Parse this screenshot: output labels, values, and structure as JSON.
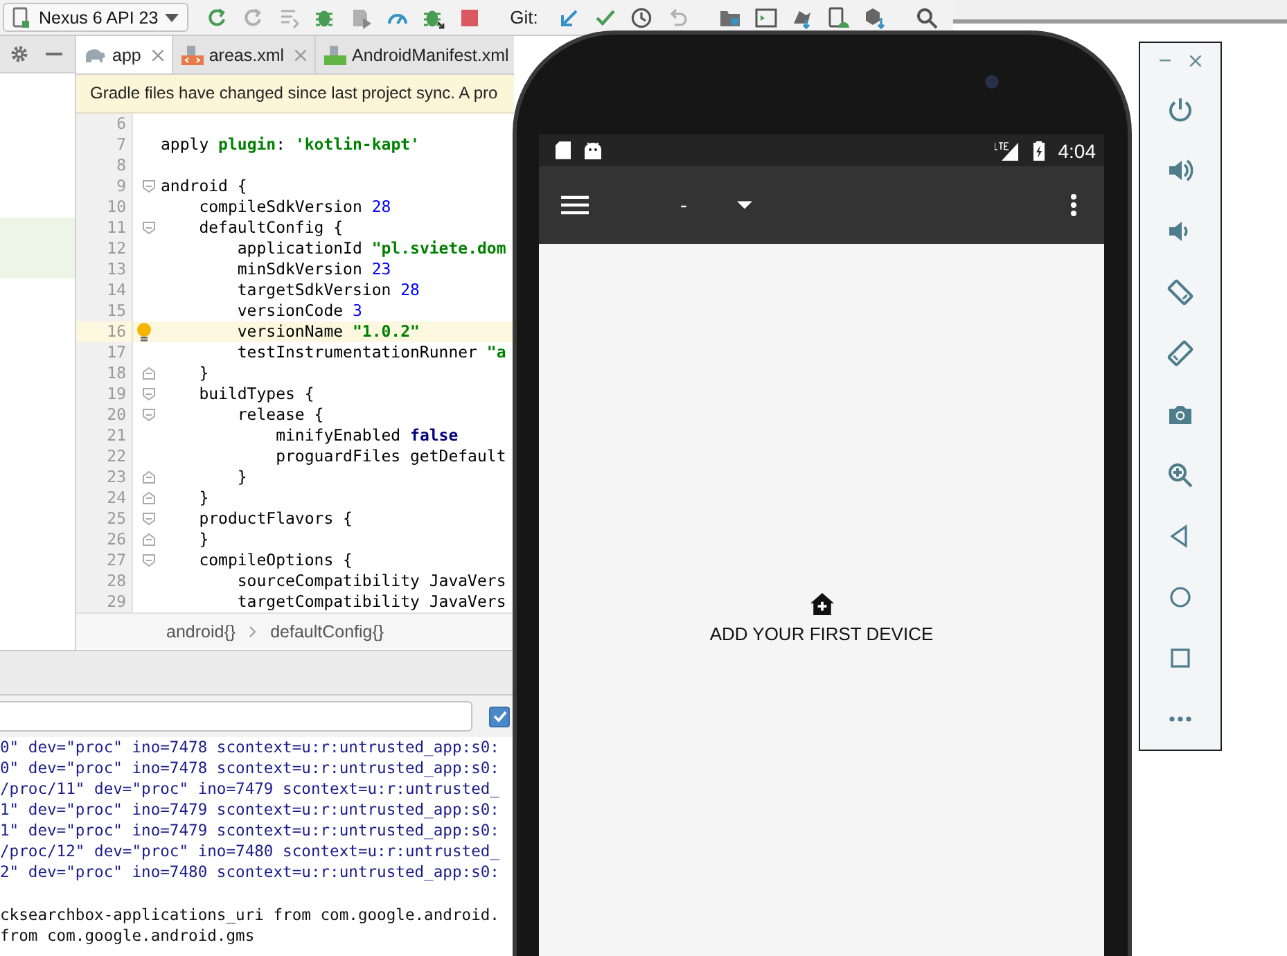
{
  "toolbar": {
    "device_selector": "Nexus 6 API 23",
    "run_buttons": [
      {
        "kind": "run",
        "disabled": false
      },
      {
        "kind": "apply-changes",
        "disabled": true
      },
      {
        "kind": "apply-code",
        "disabled": true
      },
      {
        "kind": "debug",
        "disabled": false
      },
      {
        "kind": "attach-debugger",
        "disabled": true
      },
      {
        "kind": "profile",
        "disabled": false
      },
      {
        "kind": "debug-attach",
        "disabled": false
      },
      {
        "kind": "stop",
        "disabled": false
      }
    ],
    "git_label": "Git:",
    "git_buttons": [
      {
        "kind": "update",
        "disabled": false
      },
      {
        "kind": "commit",
        "disabled": false
      },
      {
        "kind": "history",
        "disabled": false
      },
      {
        "kind": "revert",
        "disabled": true
      }
    ],
    "tool_buttons": [
      {
        "kind": "project-structure"
      },
      {
        "kind": "terminal"
      },
      {
        "kind": "sdk"
      },
      {
        "kind": "avd"
      },
      {
        "kind": "device-files"
      }
    ]
  },
  "editor_tabs": [
    {
      "label": "app",
      "kind": "gradle",
      "selected": true,
      "closable": true
    },
    {
      "label": "areas.xml",
      "kind": "xml",
      "selected": false,
      "closable": true
    },
    {
      "label": "AndroidManifest.xml",
      "kind": "manifest",
      "selected": false,
      "closable": false
    }
  ],
  "notification": "Gradle files have changed since last project sync. A pro",
  "code_lines": [
    {
      "number": "6"
    },
    {
      "number": "7",
      "tokens": [
        {
          "text": "apply ",
          "kind": "plain"
        },
        {
          "text": "plugin",
          "kind": "keyword-green"
        },
        {
          "text": ": ",
          "kind": "plain"
        },
        {
          "text": "'kotlin-kapt'",
          "kind": "string"
        }
      ]
    },
    {
      "number": "8"
    },
    {
      "number": "9",
      "fold_start": true,
      "tokens": [
        {
          "text": "android {",
          "kind": "plain"
        }
      ]
    },
    {
      "number": "10",
      "tokens": [
        {
          "text": "    compileSdkVersion ",
          "kind": "plain"
        },
        {
          "text": "28",
          "kind": "number"
        }
      ]
    },
    {
      "number": "11",
      "fold_start": true,
      "tokens": [
        {
          "text": "    defaultConfig {",
          "kind": "plain"
        }
      ]
    },
    {
      "number": "12",
      "tokens": [
        {
          "text": "        applicationId ",
          "kind": "plain"
        },
        {
          "text": "\"pl.sviete.dom",
          "kind": "string"
        }
      ]
    },
    {
      "number": "13",
      "tokens": [
        {
          "text": "        minSdkVersion ",
          "kind": "plain"
        },
        {
          "text": "23",
          "kind": "number"
        }
      ]
    },
    {
      "number": "14",
      "tokens": [
        {
          "text": "        targetSdkVersion ",
          "kind": "plain"
        },
        {
          "text": "28",
          "kind": "number"
        }
      ]
    },
    {
      "number": "15",
      "tokens": [
        {
          "text": "        versionCode ",
          "kind": "plain"
        },
        {
          "text": "3",
          "kind": "number"
        }
      ]
    },
    {
      "number": "16",
      "current": true,
      "bulb": true,
      "tokens": [
        {
          "text": "        versionName ",
          "kind": "plain"
        },
        {
          "text": "\"1.0.2\"",
          "kind": "string"
        }
      ]
    },
    {
      "number": "17",
      "tokens": [
        {
          "text": "        testInstrumentationRunner ",
          "kind": "plain"
        },
        {
          "text": "\"a",
          "kind": "string"
        }
      ]
    },
    {
      "number": "18",
      "fold_end": true,
      "tokens": [
        {
          "text": "    }",
          "kind": "plain"
        }
      ]
    },
    {
      "number": "19",
      "fold_start": true,
      "tokens": [
        {
          "text": "    buildTypes {",
          "kind": "plain"
        }
      ]
    },
    {
      "number": "20",
      "fold_start": true,
      "tokens": [
        {
          "text": "        release {",
          "kind": "plain"
        }
      ]
    },
    {
      "number": "21",
      "tokens": [
        {
          "text": "            minifyEnabled ",
          "kind": "plain"
        },
        {
          "text": "false",
          "kind": "keyword"
        }
      ]
    },
    {
      "number": "22",
      "tokens": [
        {
          "text": "            proguardFiles getDefault",
          "kind": "plain"
        }
      ]
    },
    {
      "number": "23",
      "fold_end": true,
      "tokens": [
        {
          "text": "        }",
          "kind": "plain"
        }
      ]
    },
    {
      "number": "24",
      "fold_end": true,
      "tokens": [
        {
          "text": "    }",
          "kind": "plain"
        }
      ]
    },
    {
      "number": "25",
      "fold_start": true,
      "tokens": [
        {
          "text": "    productFlavors {",
          "kind": "plain"
        }
      ]
    },
    {
      "number": "26",
      "fold_end": true,
      "tokens": [
        {
          "text": "    }",
          "kind": "plain"
        }
      ]
    },
    {
      "number": "27",
      "fold_start": true,
      "tokens": [
        {
          "text": "    compileOptions {",
          "kind": "plain"
        }
      ]
    },
    {
      "number": "28",
      "tokens": [
        {
          "text": "        sourceCompatibility JavaVers",
          "kind": "plain"
        }
      ]
    },
    {
      "number": "29",
      "tokens": [
        {
          "text": "        targetCompatibility JavaVers",
          "kind": "plain"
        }
      ]
    }
  ],
  "breadcrumbs": [
    "android{}",
    "defaultConfig{}"
  ],
  "logcat": {
    "regex_checked": true,
    "lines": [
      "0\" dev=\"proc\" ino=7478 scontext=u:r:untrusted_app:s0:",
      "0\" dev=\"proc\" ino=7478 scontext=u:r:untrusted_app:s0:",
      "/proc/11\" dev=\"proc\" ino=7479 scontext=u:r:untrusted_",
      "1\" dev=\"proc\" ino=7479 scontext=u:r:untrusted_app:s0:",
      "1\" dev=\"proc\" ino=7479 scontext=u:r:untrusted_app:s0:",
      "/proc/12\" dev=\"proc\" ino=7480 scontext=u:r:untrusted_",
      "2\" dev=\"proc\" ino=7480 scontext=u:r:untrusted_app:s0:"
    ],
    "plain_lines": [
      "cksearchbox-applications_uri from com.google.android.",
      "from com.google.android.gms"
    ]
  },
  "phone": {
    "time": "4:04",
    "app_title": "-",
    "empty_message": "ADD YOUR FIRST DEVICE"
  },
  "emulator_controls": [
    {
      "kind": "power"
    },
    {
      "kind": "volume-up"
    },
    {
      "kind": "volume-down"
    },
    {
      "kind": "rotate-left"
    },
    {
      "kind": "rotate-right"
    },
    {
      "kind": "screenshot"
    },
    {
      "kind": "zoom"
    },
    {
      "kind": "back"
    },
    {
      "kind": "home"
    },
    {
      "kind": "overview"
    },
    {
      "kind": "more"
    }
  ]
}
